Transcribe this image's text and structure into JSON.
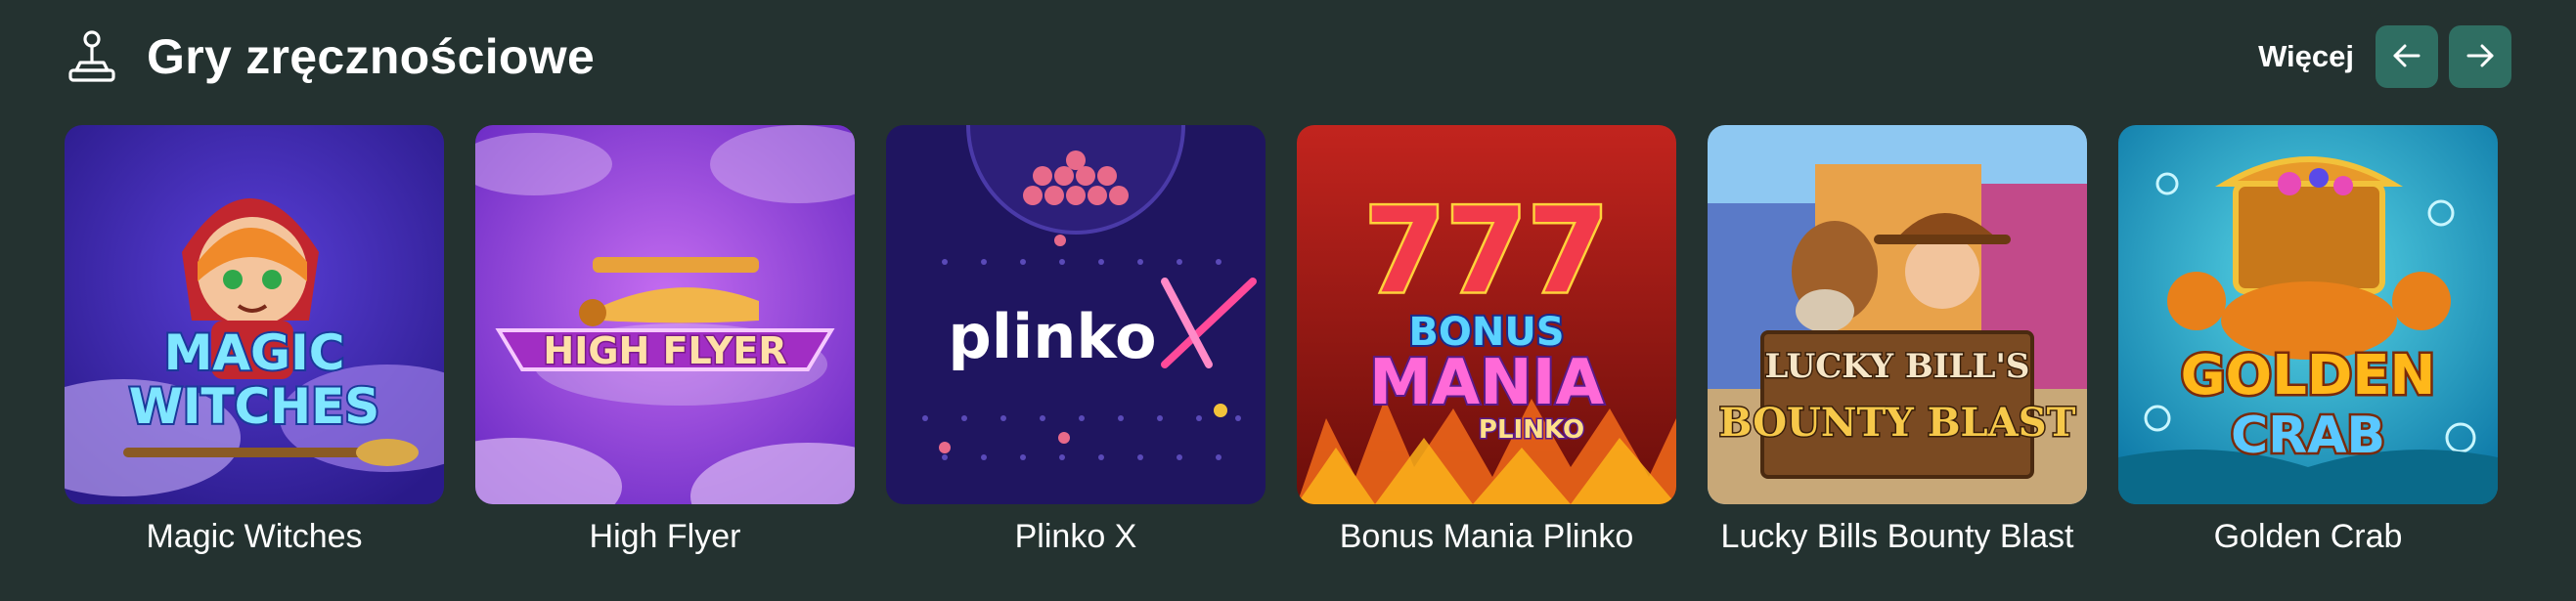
{
  "section": {
    "title": "Gry zręcznościowe",
    "icon": "joystick-icon",
    "more_label": "Więcej",
    "prev_icon": "arrow-left-icon",
    "next_icon": "arrow-right-icon"
  },
  "colors": {
    "background": "#243230",
    "nav_button": "#2f6e62",
    "text": "#ffffff"
  },
  "games": [
    {
      "name": "Magic Witches",
      "logo_line1": "MAGIC",
      "logo_line2": "WITCHES"
    },
    {
      "name": "High Flyer",
      "logo_line1": "HIGH FLYER"
    },
    {
      "name": "Plinko X",
      "logo_line1": "plinko",
      "logo_line2": "X"
    },
    {
      "name": "Bonus Mania Plinko",
      "logo_line1": "777",
      "logo_line2": "BONUS",
      "logo_line3": "MANIA",
      "logo_line4": "PLINKO"
    },
    {
      "name": "Lucky Bills Bounty Blast",
      "logo_line1": "LUCKY BILL'S",
      "logo_line2": "BOUNTY BLAST"
    },
    {
      "name": "Golden Crab",
      "logo_line1": "GOLDEN",
      "logo_line2": "CRAB"
    }
  ]
}
